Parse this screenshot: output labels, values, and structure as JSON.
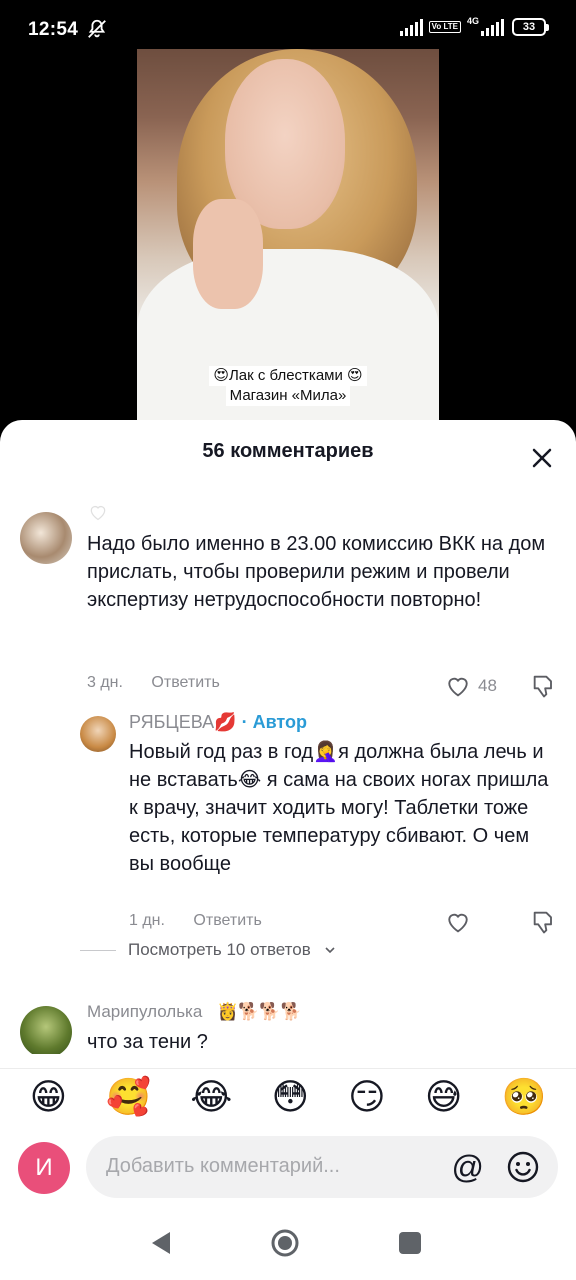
{
  "status_bar": {
    "time": "12:54",
    "battery": "33",
    "network": "4G",
    "volte": "Vo LTE"
  },
  "video": {
    "caption_line1": "😍Лак с блестками 😍",
    "caption_line2": "Магазин «Мила»"
  },
  "sheet": {
    "title": "56 комментариев"
  },
  "comments": [
    {
      "text": "Надо было именно в 23.00 комиссию ВКК на дом прислать, чтобы проверили режим и провели экспертизу нетрудоспособности повторно!",
      "age": "3 дн.",
      "reply_label": "Ответить",
      "likes": "48"
    }
  ],
  "reply": {
    "name": "РЯБЦЕВА💋",
    "author_badge": "· Автор",
    "text": "Новый год раз в год🤦‍♀️я должна была лечь и не вставать😂 я сама на своих ногах пришла к врачу, значит ходить могу! Таблетки тоже есть, которые температуру сбивают. О чем вы вообще",
    "age": "1 дн.",
    "reply_label": "Ответить"
  },
  "more_replies": "Посмотреть 10 ответов",
  "comment3": {
    "name": "Марипулолька",
    "badges": "👸🐕🐕🐕",
    "text": "что за тени ?"
  },
  "emoji_bar": [
    "😁",
    "🥰",
    "😂",
    "😳",
    "😏",
    "😅",
    "🥺"
  ],
  "composer": {
    "user_initial": "И",
    "placeholder": "Добавить комментарий...",
    "mention": "@"
  },
  "colors": {
    "author_badge": "#2a9bd6",
    "user_avatar": "#e94f7a",
    "text": "#161823",
    "muted": "#8a8b91"
  },
  "icons": [
    "mute-icon",
    "close-icon",
    "heart-icon",
    "dislike-icon",
    "chevron-down-icon",
    "smile-icon",
    "nav-back-icon",
    "nav-home-icon",
    "nav-recent-icon"
  ]
}
